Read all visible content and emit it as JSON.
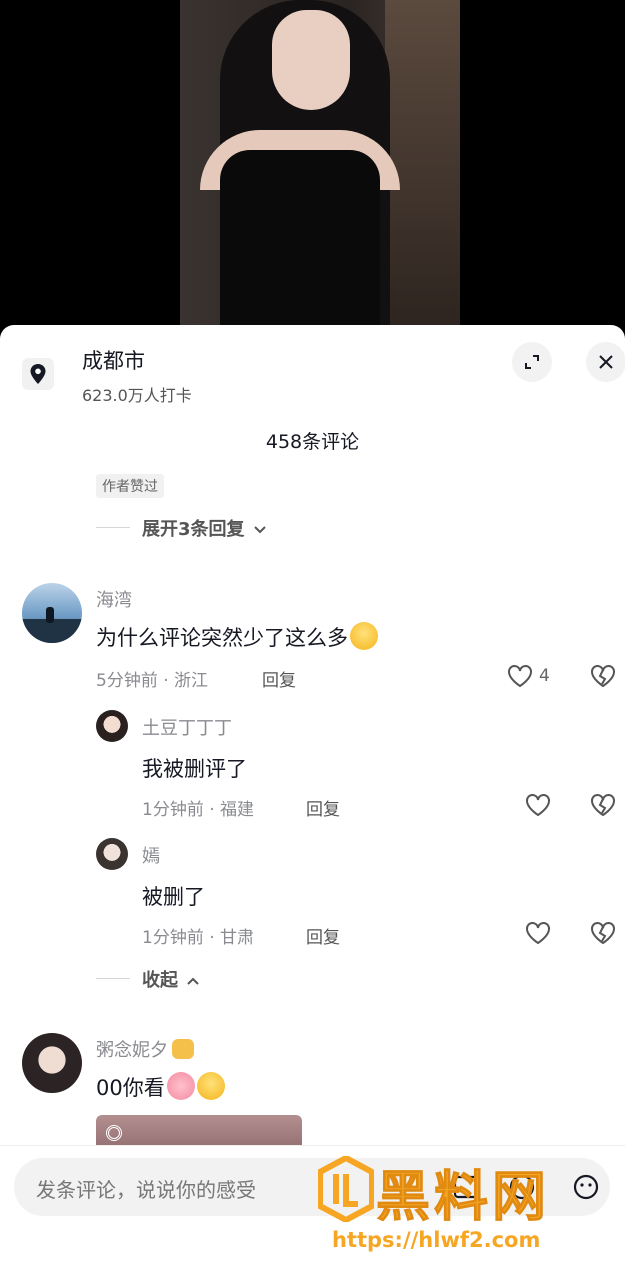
{
  "location": {
    "title": "成都市",
    "subtitle": "623.0万人打卡"
  },
  "comments_header": {
    "count_label": "458条评论"
  },
  "author_tag": "作者赞过",
  "expand_replies": "展开3条回复",
  "collapse_label": "收起",
  "comments": [
    {
      "username": "海湾",
      "text": "为什么评论突然少了这么多",
      "time_location": "5分钟前 · 浙江",
      "reply_label": "回复",
      "likes": "4",
      "replies": [
        {
          "username": "土豆丁丁丁",
          "text": "我被删评了",
          "time_location": "1分钟前 · 福建",
          "reply_label": "回复"
        },
        {
          "username": "嫣",
          "text": "被删了",
          "time_location": "1分钟前 · 甘肃",
          "reply_label": "回复"
        }
      ]
    },
    {
      "username": "粥念妮夕",
      "text": "00你看"
    }
  ],
  "input": {
    "placeholder": "发条评论，说说你的感受"
  },
  "watermark": {
    "text": "黑料网",
    "url": "https://hlwf2.com"
  },
  "colors": {
    "accent_orange": "#f6a623",
    "text_primary": "#161823",
    "text_secondary": "#8a8b91"
  }
}
